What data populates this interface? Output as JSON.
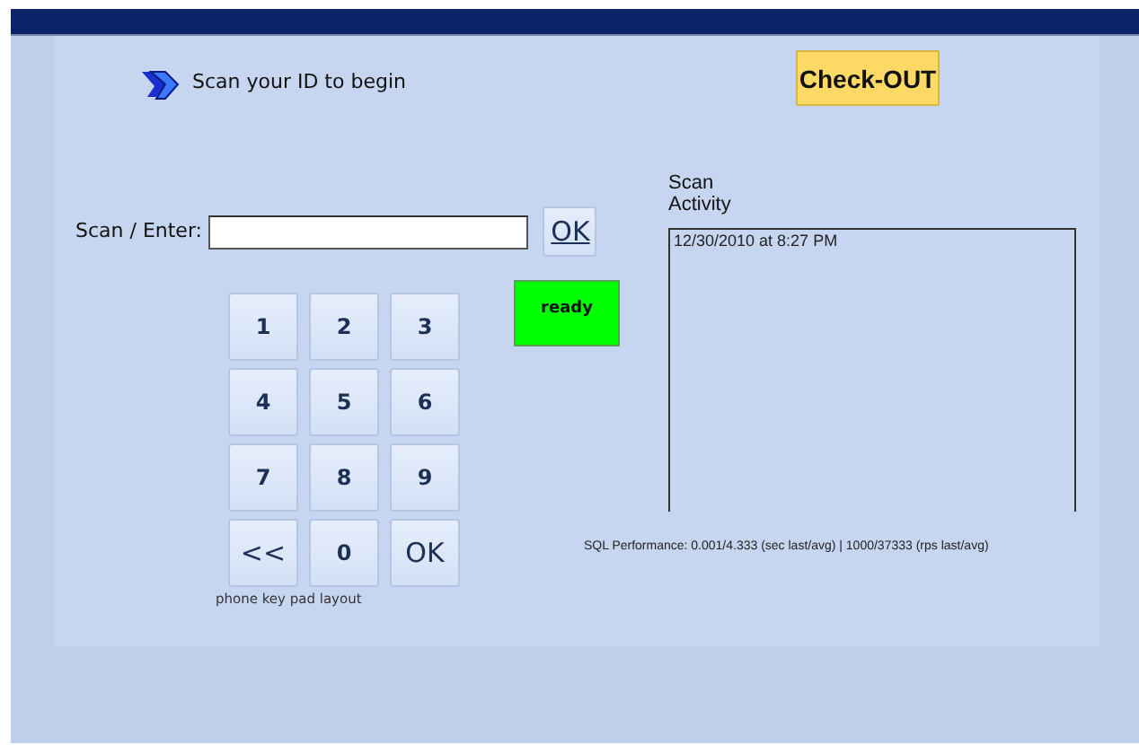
{
  "header": {
    "prompt": "Scan your ID to begin",
    "mode_button": "Check-OUT"
  },
  "scan": {
    "label": "Scan / Enter:",
    "button": "OK"
  },
  "keypad": {
    "keys": [
      {
        "label": "1",
        "kind": "digit"
      },
      {
        "label": "2",
        "kind": "digit"
      },
      {
        "label": "3",
        "kind": "digit"
      },
      {
        "label": "4",
        "kind": "digit"
      },
      {
        "label": "5",
        "kind": "digit"
      },
      {
        "label": "6",
        "kind": "digit"
      },
      {
        "label": "7",
        "kind": "digit"
      },
      {
        "label": "8",
        "kind": "digit"
      },
      {
        "label": "9",
        "kind": "digit"
      },
      {
        "label": "<<",
        "kind": "action"
      },
      {
        "label": "0",
        "kind": "digit"
      },
      {
        "label": "OK",
        "kind": "action"
      }
    ],
    "caption": "phone key pad layout"
  },
  "status": {
    "text": "ready"
  },
  "activity": {
    "title": "Scan Activity",
    "entries": [
      "12/30/2010 at 8:27 PM"
    ]
  },
  "performance": "SQL Performance: 0.001/4.333 (sec last/avg) | 1000/37333 (rps last/avg)"
}
